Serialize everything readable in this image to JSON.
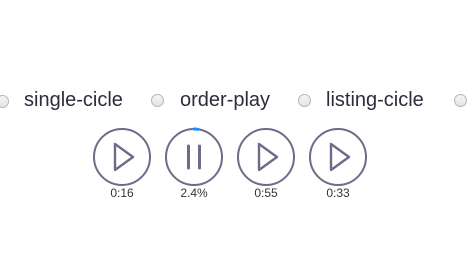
{
  "play_modes": [
    {
      "label": "single-cicle",
      "selected": false
    },
    {
      "label": "order-play",
      "selected": false
    },
    {
      "label": "listing-cicle",
      "selected": false
    }
  ],
  "players": [
    {
      "state": "paused",
      "icon": "play-icon",
      "readout": "0:16",
      "progress": 0
    },
    {
      "state": "playing",
      "icon": "pause-icon",
      "readout": "2.4%",
      "progress": 0.024
    },
    {
      "state": "paused",
      "icon": "play-icon",
      "readout": "0:55",
      "progress": 0
    },
    {
      "state": "paused",
      "icon": "play-icon",
      "readout": "0:33",
      "progress": 0
    }
  ],
  "colors": {
    "ring": "#6b6b8a",
    "progress": "#1890ff",
    "text": "#2c2c3c"
  }
}
